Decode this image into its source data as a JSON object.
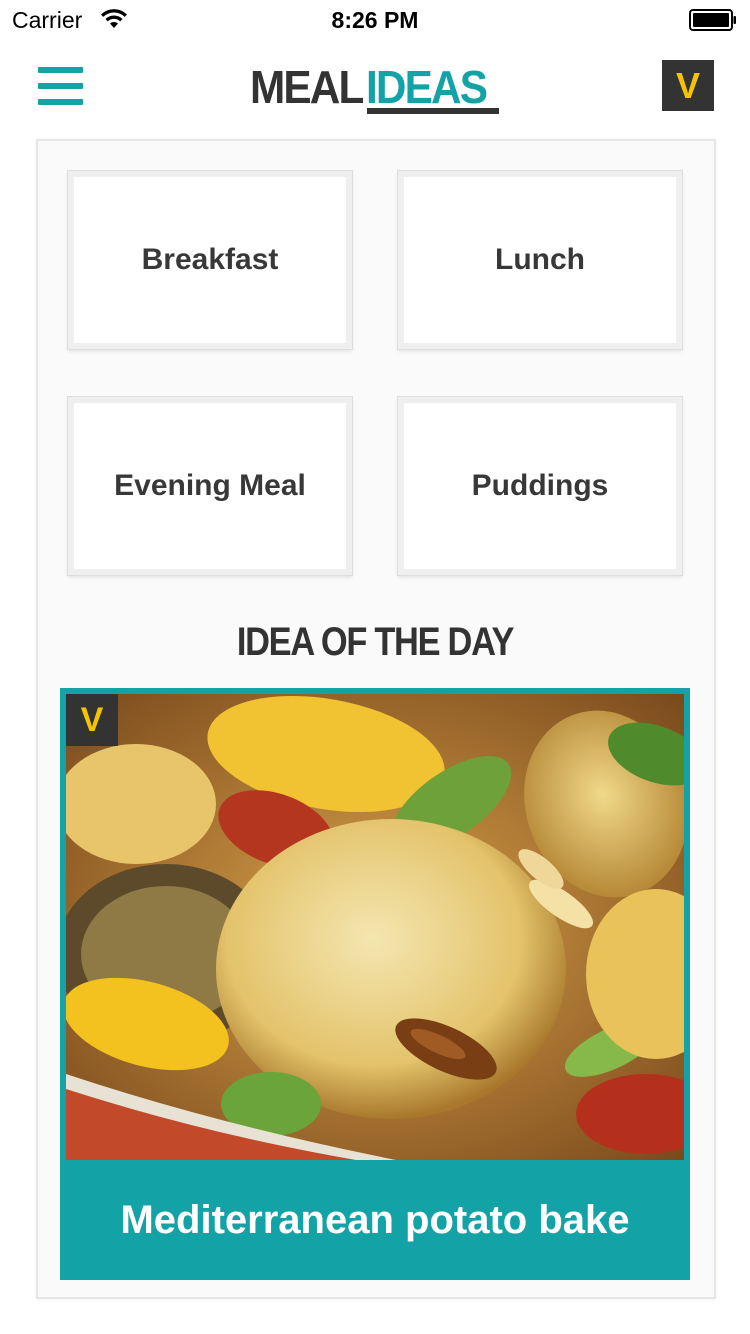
{
  "status_bar": {
    "carrier": "Carrier",
    "time": "8:26 PM",
    "wifi_icon": "wifi-icon",
    "battery_icon": "battery-icon"
  },
  "header": {
    "menu_icon": "hamburger-menu-icon",
    "logo_part1": "MEAL",
    "logo_part2": "IDEAS",
    "vegetarian_button": "V"
  },
  "categories": [
    {
      "label": "Breakfast"
    },
    {
      "label": "Lunch"
    },
    {
      "label": "Evening Meal"
    },
    {
      "label": "Puddings"
    }
  ],
  "idea_of_the_day": {
    "heading": "IDEA OF THE DAY",
    "badge": "V",
    "title": "Mediterranean potato bake"
  },
  "colors": {
    "accent": "#13a3a6",
    "dark": "#333333",
    "badge_yellow": "#f5c400"
  }
}
